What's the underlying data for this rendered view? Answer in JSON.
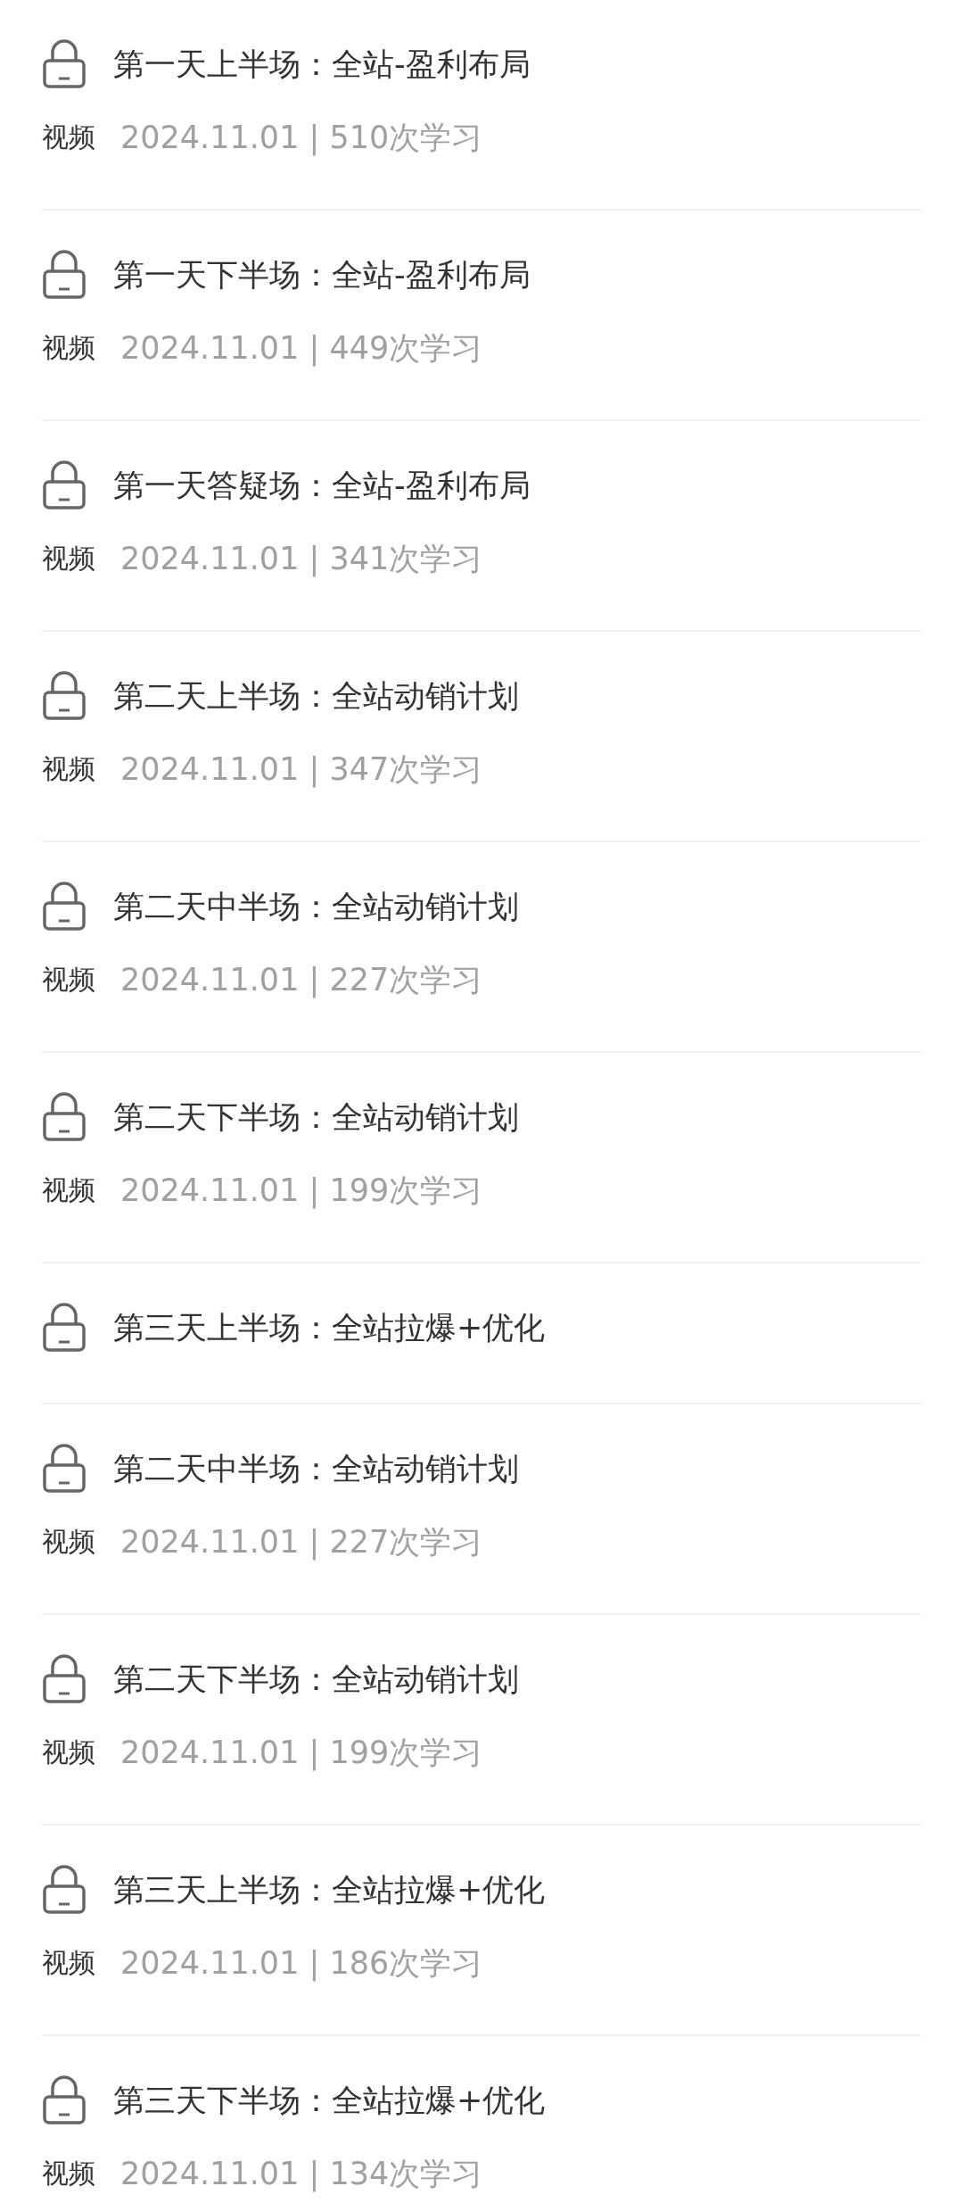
{
  "lessons": [
    {
      "title": "第一天上半场：全站-盈利布局",
      "type": "视频",
      "meta": "2024.11.01 | 510次学习"
    },
    {
      "title": "第一天下半场：全站-盈利布局",
      "type": "视频",
      "meta": "2024.11.01 | 449次学习"
    },
    {
      "title": "第一天答疑场：全站-盈利布局",
      "type": "视频",
      "meta": "2024.11.01 | 341次学习"
    },
    {
      "title": "第二天上半场：全站动销计划",
      "type": "视频",
      "meta": "2024.11.01 | 347次学习"
    },
    {
      "title": "第二天中半场：全站动销计划",
      "type": "视频",
      "meta": "2024.11.01 | 227次学习"
    },
    {
      "title": "第二天下半场：全站动销计划",
      "type": "视频",
      "meta": "2024.11.01 | 199次学习"
    },
    {
      "title": "第三天上半场：全站拉爆+优化"
    },
    {
      "title": "第二天中半场：全站动销计划",
      "type": "视频",
      "meta": "2024.11.01 | 227次学习"
    },
    {
      "title": "第二天下半场：全站动销计划",
      "type": "视频",
      "meta": "2024.11.01 | 199次学习"
    },
    {
      "title": "第三天上半场：全站拉爆+优化",
      "type": "视频",
      "meta": "2024.11.01 | 186次学习"
    },
    {
      "title": "第三天下半场：全站拉爆+优化",
      "type": "视频",
      "meta": "2024.11.01 | 134次学习"
    }
  ]
}
